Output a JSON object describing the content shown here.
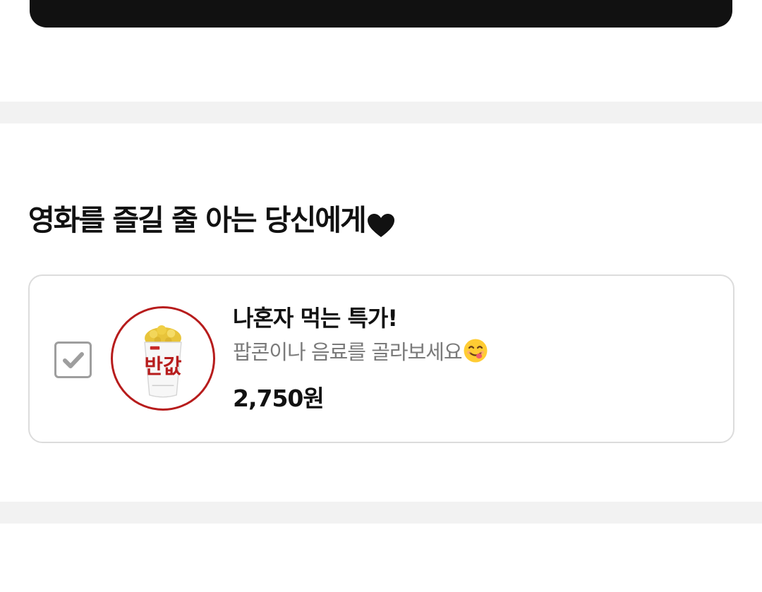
{
  "section": {
    "title": "영화를 즐길 줄 아는 당신에게",
    "title_icon": "heart-icon"
  },
  "product": {
    "checked": true,
    "image_text": "반값",
    "name": "나혼자 먹는 특가!",
    "description": "팝콘이나 음료를 골라보세요",
    "description_icon": "yum-emoji-icon",
    "price": "2,750원"
  },
  "colors": {
    "accent_red": "#b71c1c",
    "divider_gray": "#f2f2f2",
    "checkbox_gray": "#9e9e9e",
    "text_primary": "#111111",
    "text_secondary": "#7a7a7a"
  }
}
